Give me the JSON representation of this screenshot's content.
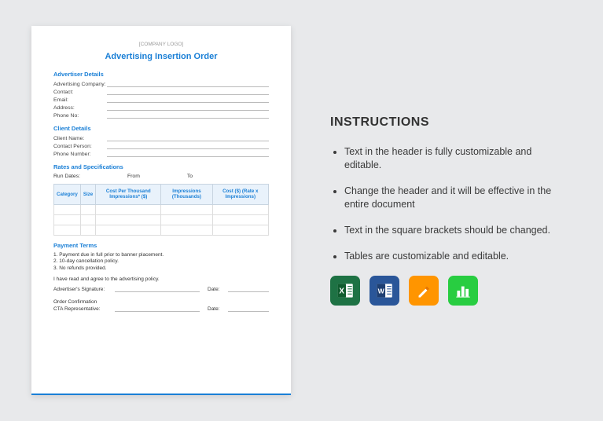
{
  "doc": {
    "logo": "[COMPANY LOGO]",
    "title": "Advertising Insertion Order",
    "sections": {
      "advertiser": {
        "heading": "Advertiser Details",
        "fields": [
          "Advertising Company:",
          "Contact:",
          "Email:",
          "Address:",
          "Phone No:"
        ]
      },
      "client": {
        "heading": "Client Details",
        "fields": [
          "Client Name:",
          "Contact Person:",
          "Phone Number:"
        ]
      },
      "rates": {
        "heading": "Rates and Specifications",
        "runDates": "Run Dates:",
        "from": "From",
        "to": "To",
        "cols": [
          "Category",
          "Size",
          "Cost Per Thousand Impressions* ($)",
          "Impressions (Thousands)",
          "Cost ($) (Rate x Impressions)"
        ]
      },
      "payment": {
        "heading": "Payment Terms",
        "items": [
          "1. Payment due in full prior to banner placement.",
          "2. 10-day cancellation policy.",
          "3. No refunds provided."
        ]
      },
      "agree": "I have read and agree to the advertising policy.",
      "signatures": {
        "advertiser": "Advertiser's Signature:",
        "date": "Date:",
        "orderConf": "Order Confirmation",
        "cta": "CTA Representative:"
      }
    }
  },
  "instructions": {
    "heading": "INSTRUCTIONS",
    "items": [
      "Text in the header is fully customizable and editable.",
      "Change the header and it will be effective in the entire document",
      "Text in the square brackets should be changed.",
      "Tables are customizable and editable."
    ]
  },
  "apps": [
    "excel",
    "word",
    "pages",
    "numbers"
  ]
}
